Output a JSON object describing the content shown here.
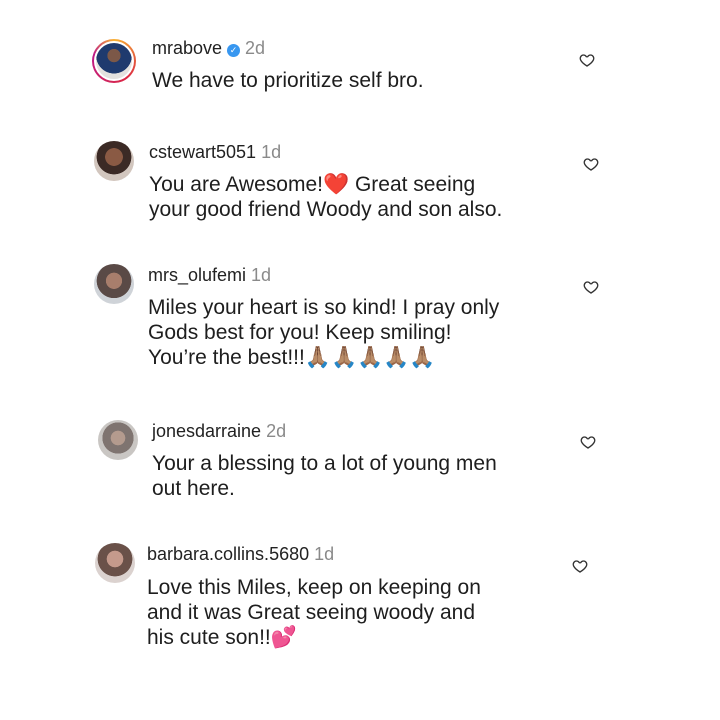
{
  "comments": [
    {
      "username": "mrabove",
      "verified": true,
      "time": "2d",
      "text": "We have to prioritize self bro."
    },
    {
      "username": "cstewart5051",
      "verified": false,
      "time": "1d",
      "text": "You are Awesome!❤️ Great seeing\nyour good friend Woody and son also."
    },
    {
      "username": "mrs_olufemi",
      "verified": false,
      "time": "1d",
      "text": "Miles your heart is so kind! I pray only\nGods best for you! Keep smiling!\nYou’re the best!!!🙏🏽🙏🏽🙏🏽🙏🏽🙏🏽"
    },
    {
      "username": "jonesdarraine",
      "verified": false,
      "time": "2d",
      "text": "Your a blessing to a lot of young men\nout here."
    },
    {
      "username": "barbara.collins.5680",
      "verified": false,
      "time": "1d",
      "text": "Love this Miles, keep on keeping on\nand it was Great seeing woody and\nhis cute son!!💕"
    }
  ],
  "icons": {
    "like": "heart-outline-icon",
    "verified": "verified-badge-icon"
  },
  "colors": {
    "verified": "#3897f0",
    "time": "#8a8a8a"
  }
}
